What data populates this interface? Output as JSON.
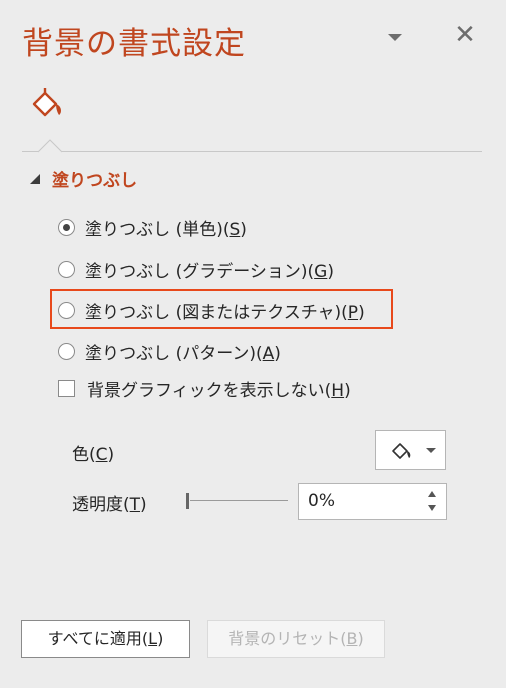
{
  "pane": {
    "title": "背景の書式設定",
    "close_glyph": "✕"
  },
  "section": {
    "label": "塗りつぶし"
  },
  "fill_options": [
    {
      "text": "塗りつぶし (単色)(",
      "key": "S",
      "close": ")",
      "checked": true
    },
    {
      "text": "塗りつぶし (グラデーション)(",
      "key": "G",
      "close": ")",
      "checked": false
    },
    {
      "text": "塗りつぶし (図またはテクスチャ)(",
      "key": "P",
      "close": ")",
      "checked": false
    },
    {
      "text": "塗りつぶし (パターン)(",
      "key": "A",
      "close": ")",
      "checked": false
    }
  ],
  "hide_graphics": {
    "text": "背景グラフィックを表示しない(",
    "key": "H",
    "close": ")",
    "checked": false
  },
  "color": {
    "label_text": "色(",
    "label_key": "C",
    "label_close": ")"
  },
  "transparency": {
    "label_text": "透明度(",
    "label_key": "T",
    "label_close": ")",
    "value": "0%"
  },
  "buttons": {
    "apply_all_text": "すべてに適用(",
    "apply_all_key": "L",
    "apply_all_close": ")",
    "reset_text": "背景のリセット(",
    "reset_key": "B",
    "reset_close": ")"
  },
  "colors": {
    "accent": "#c0461f",
    "highlight": "#e8491b"
  }
}
